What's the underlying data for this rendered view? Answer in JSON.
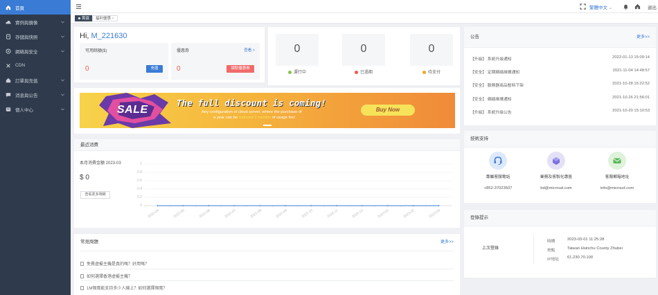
{
  "sidebar": {
    "items": [
      {
        "label": "首頁",
        "icon": "home-icon",
        "active": true
      },
      {
        "label": "實例與鏡像",
        "icon": "cloud-icon",
        "chevron": true
      },
      {
        "label": "存儲與快照",
        "icon": "storage-icon",
        "chevron": true
      },
      {
        "label": "網絡與安全",
        "icon": "network-icon",
        "chevron": true
      },
      {
        "label": "CDN",
        "icon": "cdn-icon"
      },
      {
        "label": "訂單與充值",
        "icon": "order-icon",
        "chevron": true
      },
      {
        "label": "消息與公告",
        "icon": "message-icon",
        "chevron": true
      },
      {
        "label": "個人中心",
        "icon": "user-icon",
        "chevron": true
      }
    ]
  },
  "topbar": {
    "language": "繁體中文",
    "logout": "退出"
  },
  "tabs": [
    {
      "label": "首頁",
      "active": true
    },
    {
      "label": "福利優惠"
    }
  ],
  "welcome": {
    "greeting_prefix": "Hi, ",
    "username": "M_221630",
    "balance_label": "可用餘額($)",
    "balance_value": "0",
    "recharge_button": "充值",
    "coupon_label": "優惠券",
    "coupon_value": "0",
    "view_link": "查看 >",
    "claim_button": "領取優惠券"
  },
  "stats": [
    {
      "value": "0",
      "label": "運行中",
      "color": "#8bc34a"
    },
    {
      "value": "0",
      "label": "已過期",
      "color": "#f05a4a"
    },
    {
      "value": "0",
      "label": "待支付",
      "color": "#f5a623"
    }
  ],
  "banner": {
    "sale": "SALE",
    "headline": "The full discount is coming!",
    "line1": "Any configuration of cloud server, where the purchase of",
    "line2_pre": "a year can be ",
    "line2_hl": "reduced 2 months",
    "line2_post": " of usage fee!",
    "cta": "Buy Now"
  },
  "consumption": {
    "title": "最近消費",
    "month_label": "本月消費金額 2023-03",
    "amount": "$ 0",
    "more_button": "查看更多明細"
  },
  "chart_data": {
    "type": "line",
    "x": [
      "2022-04",
      "2022-05",
      "2022-06",
      "2022-07",
      "2022-08",
      "2022-09",
      "2022-10",
      "2022-11",
      "2022-12",
      "2023-01",
      "2023-02",
      "2023-03"
    ],
    "series": [
      {
        "values": [
          0,
          0,
          0,
          0,
          0,
          0,
          0,
          0,
          0,
          0,
          0,
          0
        ]
      }
    ],
    "yticks": [
      "1",
      "0.8",
      "0.6",
      "0.4",
      "0.2",
      "0"
    ],
    "ylim": [
      0,
      1
    ],
    "grid": true,
    "color": "#3a7bd5"
  },
  "faq": {
    "title": "常見問題",
    "more": "更多>>",
    "items": [
      "免費虛擬主機是真的嗎？好用嗎？",
      "如何選擇香港虛擬主機？",
      "1M頻寬能支持多少人線上？如何選擇頻寬？"
    ]
  },
  "notices": {
    "title": "公告",
    "more": "更多>>",
    "items": [
      {
        "text": "【升級】 系統升級通知",
        "date": "2022-01-13 15:09:14"
      },
      {
        "text": "【安全】 定期網絡維護通知",
        "date": "2021-11-04 14:48:57"
      },
      {
        "text": "【安全】 服務器商品暫時下架",
        "date": "2021-10-28 15:22:52"
      },
      {
        "text": "【安全】 網絡維護通知",
        "date": "2021-10-26 21:56:01"
      },
      {
        "text": "【升級】 系統升級公告",
        "date": "2021-10-20 15:10:53"
      }
    ]
  },
  "support": {
    "title": "技術支持",
    "items": [
      {
        "name": "專屬客服電話",
        "value": "+852-37023507",
        "icon": "headset-icon",
        "bg": "#dde9fb",
        "fg": "#3a7bd5"
      },
      {
        "name": "業務及客製化專區",
        "value": "bd@microud.com",
        "icon": "business-icon",
        "bg": "#e4e1f7",
        "fg": "#6b5fd3"
      },
      {
        "name": "客服郵箱地址",
        "value": "info@microud.com",
        "icon": "mail-icon",
        "bg": "#dff2dc",
        "fg": "#4caf50"
      }
    ]
  },
  "login": {
    "title": "登錄提示",
    "last_login": "上次登錄",
    "time_label": "時間",
    "time_value": "2023-03-01 11:25:28",
    "location_label": "地點",
    "location_value": "Taiwan Hsinchu County Zhubei",
    "ip_label": "IP地址",
    "ip_value": "61.230.70.100"
  }
}
